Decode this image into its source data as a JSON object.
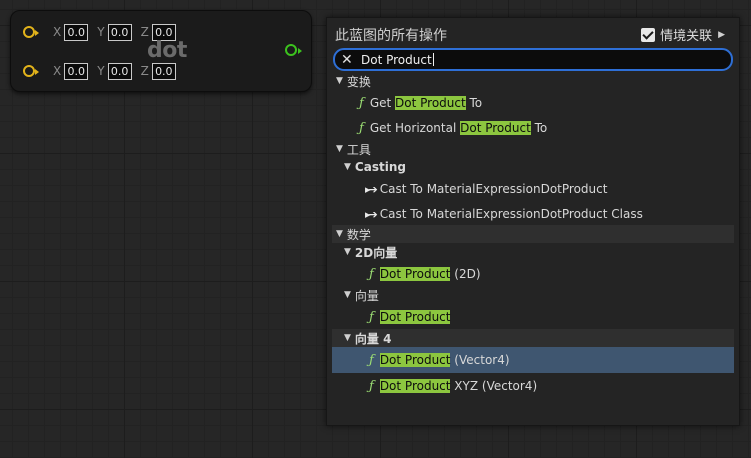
{
  "node": {
    "title": "dot",
    "rows": [
      {
        "x_label": "X",
        "x": "0.0",
        "y_label": "Y",
        "y": "0.0",
        "z_label": "Z",
        "z": "0.0"
      },
      {
        "x_label": "X",
        "x": "0.0",
        "y_label": "Y",
        "y": "0.0",
        "z_label": "Z",
        "z": "0.0"
      }
    ],
    "colors": {
      "input_pin": "#e2b31b",
      "output_pin": "#3cc21e"
    }
  },
  "menu": {
    "header": "此蓝图的所有操作",
    "context_label": "情境关联",
    "context_checked": true,
    "search_value": "Dot Product",
    "highlight_color": "#8cc63f",
    "items": {
      "cat_transform": "变换",
      "get_dot_pre": "Get ",
      "get_dot_hl": "Dot Product",
      "get_dot_post": " To",
      "get_hdot_pre": "Get Horizontal ",
      "get_hdot_hl": "Dot Product",
      "get_hdot_post": " To",
      "cat_tools": "工具",
      "sub_casting": "Casting",
      "cast1": "Cast To MaterialExpressionDotProduct",
      "cast2": "Cast To MaterialExpressionDotProduct Class",
      "cat_math": "数学",
      "sub_2d": "2D向量",
      "dp2d_hl": "Dot Product",
      "dp2d_post": " (2D)",
      "sub_vec": "向量",
      "dpvec_hl": "Dot Product",
      "sub_vec4": "向量 4",
      "dpv4_hl": "Dot Product",
      "dpv4_post": " (Vector4)",
      "dpxyz_hl": "Dot Product",
      "dpxyz_post": " XYZ (Vector4)"
    }
  }
}
